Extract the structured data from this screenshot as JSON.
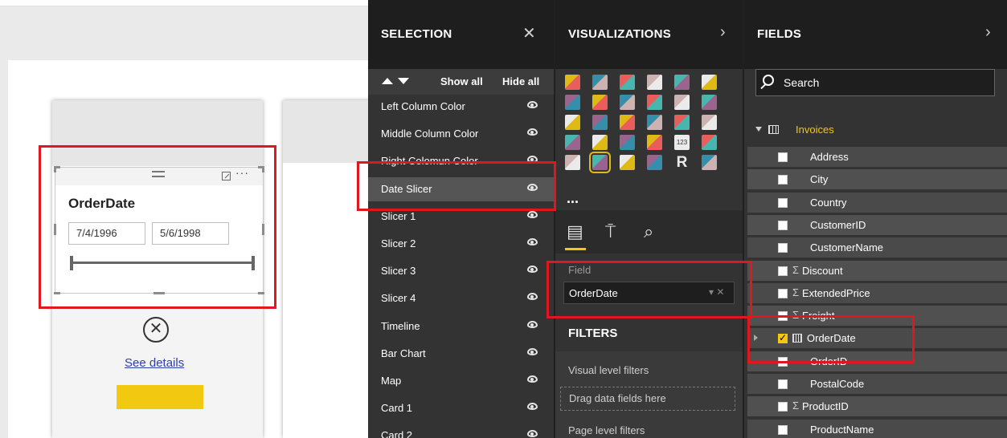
{
  "canvas": {
    "slicer": {
      "title": "OrderDate",
      "start_date": "7/4/1996",
      "end_date": "5/6/1998",
      "more": "···"
    },
    "see_details": "See details",
    "close_glyph": "✕"
  },
  "selection": {
    "title": "SELECTION",
    "close": "✕",
    "show_all": "Show all",
    "hide_all": "Hide all",
    "items": [
      "Left Column Color",
      "Middle Column Color",
      "Right Colomun Color",
      "Date Slicer",
      "Slicer 1",
      "Slicer 2",
      "Slicer 3",
      "Slicer 4",
      "Timeline",
      "Bar Chart",
      "Map",
      "Card 1",
      "Card 2"
    ],
    "active_index": 3
  },
  "visualizations": {
    "title": "VISUALIZATIONS",
    "expand": "›",
    "more": "...",
    "icons": [
      "stacked-bar-icon",
      "stacked-column-icon",
      "clustered-bar-icon",
      "clustered-column-icon",
      "percent-bar-icon",
      "percent-column-icon",
      "line-chart-icon",
      "area-chart-icon",
      "stacked-area-icon",
      "line-column-icon",
      "line-clustered-icon",
      "ribbon-chart-icon",
      "waterfall-icon",
      "scatter-icon",
      "pie-chart-icon",
      "donut-chart-icon",
      "treemap-icon",
      "map-icon",
      "filled-map-icon",
      "shape-map-icon",
      "funnel-icon",
      "gauge-icon",
      "card-icon",
      "multirow-card-icon",
      "kpi-icon",
      "slicer-icon",
      "table-icon",
      "matrix-icon",
      "r-visual-icon",
      "globe-icon"
    ],
    "r_glyph": "R",
    "card_glyph": "123",
    "field_label": "Field",
    "field_value": "OrderDate",
    "field_controls": "▾ ✕",
    "filters_title": "FILTERS",
    "visual_filters": "Visual level filters",
    "drag_here": "Drag data fields here",
    "page_filters": "Page level filters"
  },
  "fields": {
    "title": "FIELDS",
    "expand": "›",
    "search_placeholder": "Search",
    "table_name": "Invoices",
    "items": [
      {
        "name": "Address",
        "sigma": false,
        "checked": false,
        "date": false
      },
      {
        "name": "City",
        "sigma": false,
        "checked": false,
        "date": false
      },
      {
        "name": "Country",
        "sigma": false,
        "checked": false,
        "date": false
      },
      {
        "name": "CustomerID",
        "sigma": false,
        "checked": false,
        "date": false
      },
      {
        "name": "CustomerName",
        "sigma": false,
        "checked": false,
        "date": false
      },
      {
        "name": "Discount",
        "sigma": true,
        "checked": false,
        "date": false
      },
      {
        "name": "ExtendedPrice",
        "sigma": true,
        "checked": false,
        "date": false
      },
      {
        "name": "Freight",
        "sigma": true,
        "checked": false,
        "date": false
      },
      {
        "name": "OrderDate",
        "sigma": false,
        "checked": true,
        "date": true
      },
      {
        "name": "OrderID",
        "sigma": false,
        "checked": false,
        "date": false
      },
      {
        "name": "PostalCode",
        "sigma": false,
        "checked": false,
        "date": false
      },
      {
        "name": "ProductID",
        "sigma": true,
        "checked": false,
        "date": false
      },
      {
        "name": "ProductName",
        "sigma": false,
        "checked": false,
        "date": false
      }
    ],
    "sigma_glyph": "Σ"
  },
  "colors": {
    "accent": "#f2c811",
    "highlight": "#e0171f",
    "pane": "#333333",
    "link": "#2f3ea8"
  }
}
